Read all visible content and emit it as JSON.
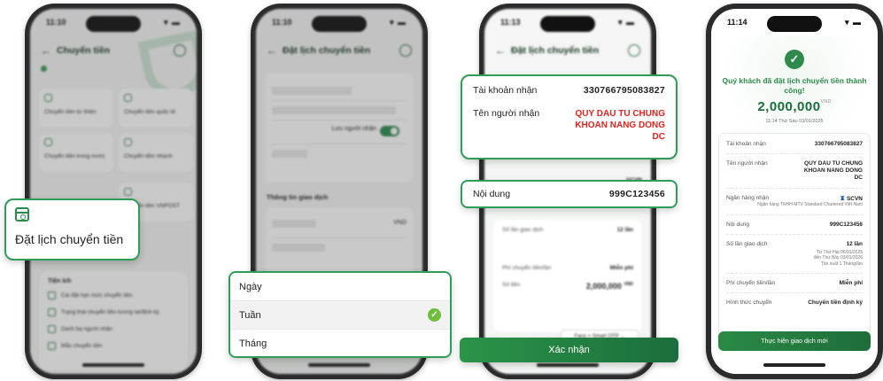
{
  "screens": {
    "s1": {
      "time": "11:10",
      "header_title": "Chuyển tiền",
      "tiles": [
        "Chuyển tiền từ thiện",
        "Chuyển tiền quốc tế",
        "Chuyển tiền trong nước",
        "Chuyển tiền nhanh",
        "",
        "Chuyển tiền VNPOST"
      ],
      "utilities_title": "Tiện ích",
      "utilities": [
        "Cài đặt hạn mức chuyển tiền",
        "Trạng thái chuyển tiền tương lai/định kỳ",
        "Danh bạ người nhận",
        "Mẫu chuyển tiền"
      ]
    },
    "s2": {
      "time": "11:10",
      "header_title": "Đặt lịch chuyển tiền",
      "save_recipient_label": "Lưu người nhận",
      "section_title": "Thông tin giao dịch",
      "currency": "VND"
    },
    "s3": {
      "time": "11:13",
      "header_title": "Đặt lịch chuyển tiền",
      "bank_code": "SCVN",
      "count_label": "Số lần giao dịch",
      "count_value": "12 lần",
      "fee_label": "Phí chuyển tiền/lần",
      "fee_value": "Miễn phí",
      "amount_label": "Số tiền",
      "amount_value": "2,000,000",
      "amount_unit": "VND",
      "method_value": "Face + Smart OTP"
    },
    "s4": {
      "time": "11:14",
      "success_title": "Quý khách đã đặt lịch chuyển tiền thành công!",
      "amount": "2,000,000",
      "currency": "VND",
      "datetime": "11:14 Thứ Sáu 03/01/2025",
      "account_label": "Tài khoản nhận",
      "account_value": "330766795083827",
      "name_label": "Tên người nhận",
      "name_value": "QUY DAU TU CHUNG KHOAN NANG DONG DC",
      "bank_label": "Ngân hàng nhận",
      "bank_code": "SCVN",
      "bank_full": "Ngân hàng TNHH MTV Standard Chartered Việt Nam",
      "content_label": "Nội dung",
      "content_value": "999C123456",
      "count_label": "Số lần giao dịch",
      "count_value": "12 lần",
      "count_note_1": "Từ Thứ Hai 06/01/2025",
      "count_note_2": "đến Thứ Bảy 03/01/2026",
      "count_note_3": "Tần suất 1 Tháng/lần",
      "fee_label": "Phí chuyển tiền/lần",
      "fee_value": "Miễn phí",
      "type_label": "Hình thức chuyển",
      "type_value": "Chuyển tiền định kỳ",
      "new_tx_button": "Thực hiện giao dịch mới"
    }
  },
  "popouts": {
    "schedule_label": "Đặt lịch chuyển tiền",
    "frequency_options": [
      "Ngày",
      "Tuần",
      "Tháng"
    ],
    "selected_frequency": "Tuần",
    "recipient_account_label": "Tài khoản nhận",
    "recipient_account_value": "330766795083827",
    "recipient_name_label": "Tên người nhận",
    "recipient_name_value": "QUY DAU TU CHUNG KHOAN NANG DONG DC",
    "content_label": "Nội dung",
    "content_value": "999C123456",
    "confirm_button": "Xác nhận"
  },
  "colors": {
    "brand_green": "#2d8a4a",
    "accent_red": "#e0231e",
    "highlight_border": "#2f9d58"
  }
}
